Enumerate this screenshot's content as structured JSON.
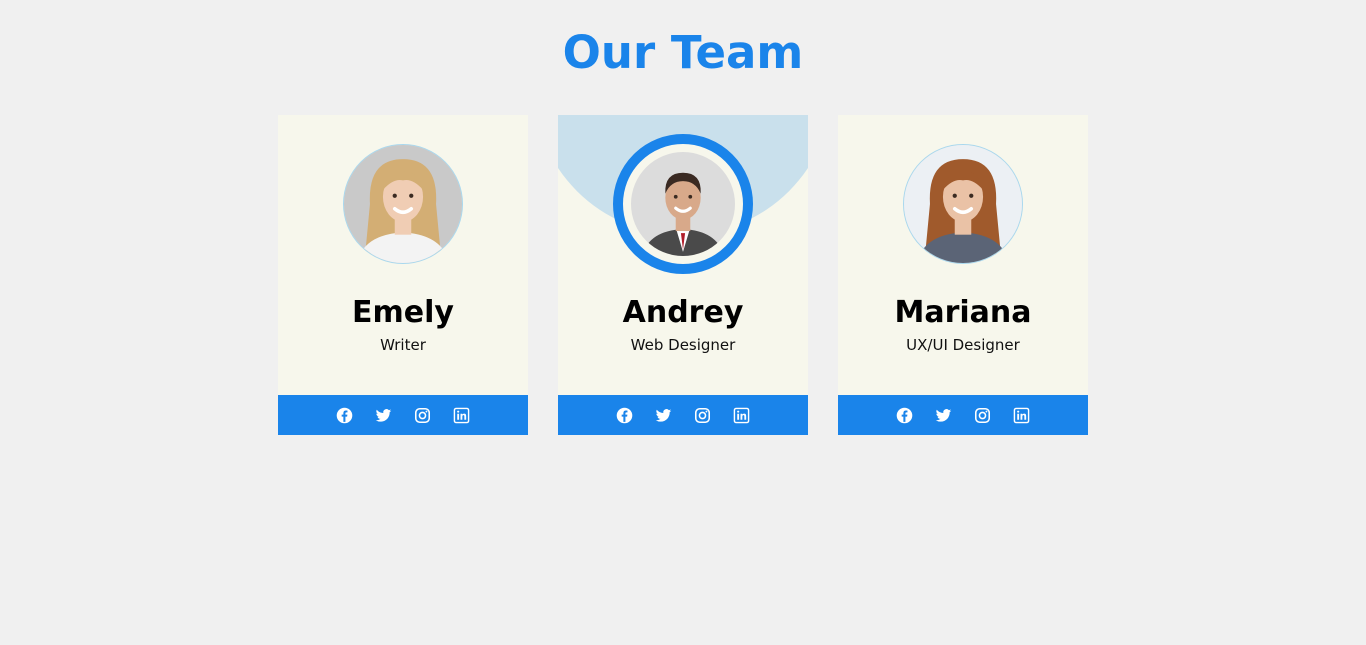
{
  "header": {
    "title": "Our Team"
  },
  "members": [
    {
      "name": "Emely",
      "role": "Writer",
      "active": false,
      "avatar": {
        "hair": "#d3ae74",
        "skin": "#f0cdb4",
        "shirt": "#f3f3f3",
        "bg": "#c9c9c9"
      }
    },
    {
      "name": "Andrey",
      "role": "Web Designer",
      "active": true,
      "avatar": {
        "hair": "#3a2a22",
        "skin": "#d8a98a",
        "shirt": "#4a4a4a",
        "bg": "#dcdcdc"
      }
    },
    {
      "name": "Mariana",
      "role": "UX/UI Designer",
      "active": false,
      "avatar": {
        "hair": "#a05a2c",
        "skin": "#eac2a6",
        "shirt": "#5b6476",
        "bg": "#ecf0f4"
      }
    }
  ],
  "social_icons": [
    "facebook-icon",
    "twitter-icon",
    "instagram-icon",
    "linkedin-icon"
  ],
  "colors": {
    "accent": "#1a84ea",
    "card_bg": "#f7f7ec",
    "halo": "#c9e0ec",
    "page_bg": "#f0f0f0"
  }
}
